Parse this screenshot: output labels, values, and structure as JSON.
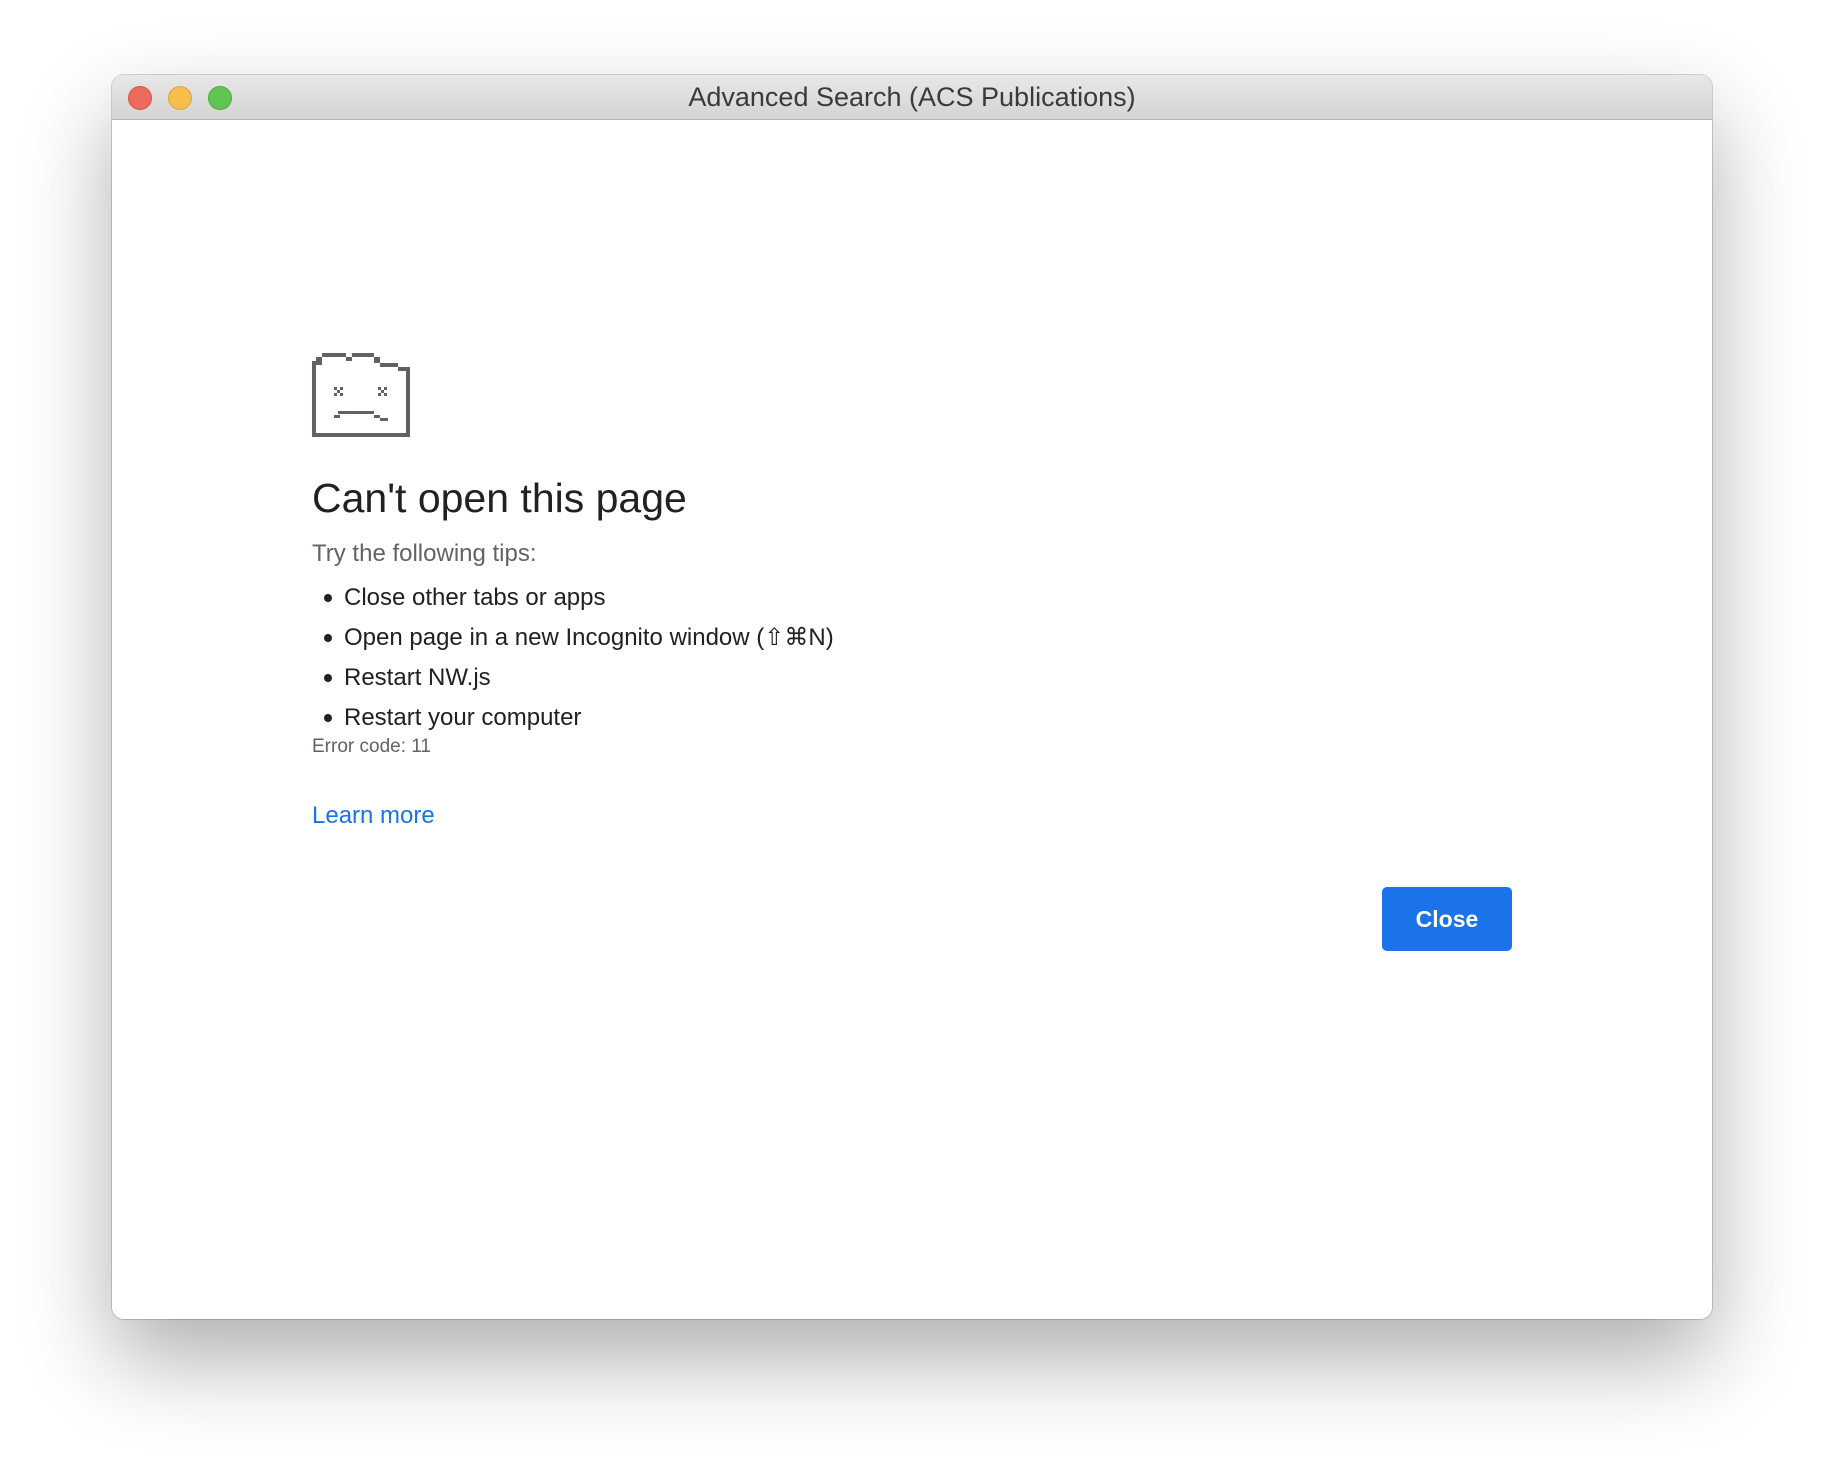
{
  "window": {
    "title": "Advanced Search (ACS Publications)"
  },
  "error": {
    "icon": "sad-tab-icon",
    "headline": "Can't open this page",
    "tips_intro": "Try the following tips:",
    "tips": [
      "Close other tabs or apps",
      "Open page in a new Incognito window (⇧⌘N)",
      "Restart NW.js",
      "Restart your computer"
    ],
    "error_code": "Error code: 11",
    "learn_more_label": "Learn more",
    "close_label": "Close"
  },
  "colors": {
    "accent": "#1a73e8",
    "title_bar": "#e0e0e0",
    "traffic_close": "#ed6a5e",
    "traffic_minimize": "#f5bf4f",
    "traffic_zoom": "#61c554"
  }
}
